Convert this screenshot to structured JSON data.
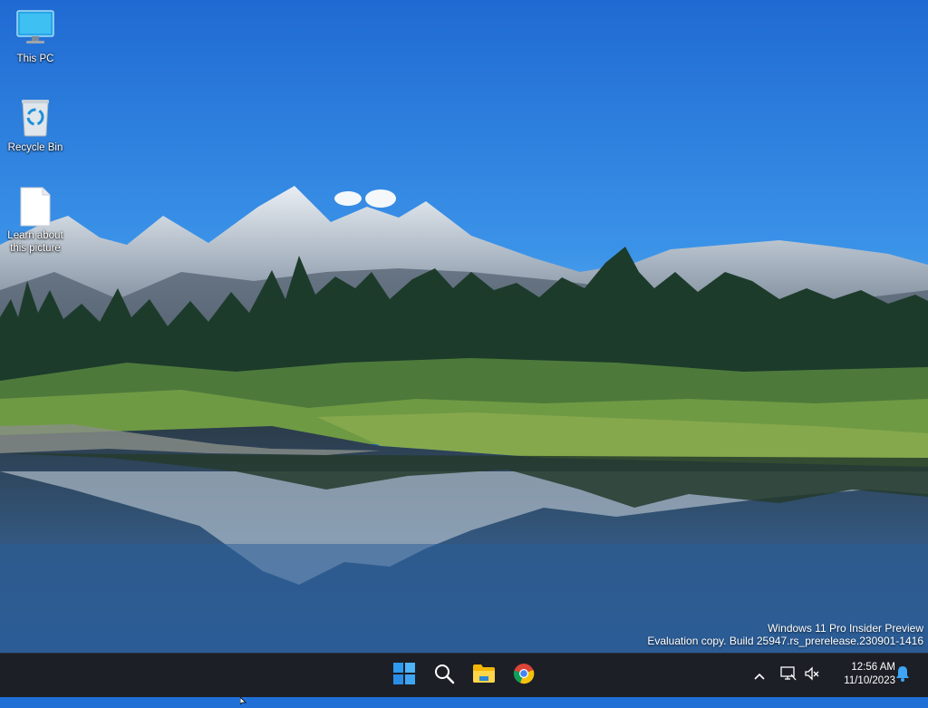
{
  "desktop": {
    "icons": [
      {
        "label": "This PC",
        "icon": "monitor-icon"
      },
      {
        "label": "Recycle Bin",
        "icon": "recycle-bin-icon"
      },
      {
        "label": "Learn about this picture",
        "icon": "document-icon"
      }
    ]
  },
  "watermark": {
    "line1": "Windows 11 Pro Insider Preview",
    "line2": "Evaluation copy. Build 25947.rs_prerelease.230901-1416"
  },
  "taskbar": {
    "pinned": [
      {
        "name": "Start",
        "icon": "windows-logo-icon"
      },
      {
        "name": "Search",
        "icon": "search-icon"
      },
      {
        "name": "File Explorer",
        "icon": "folder-icon"
      },
      {
        "name": "Google Chrome",
        "icon": "chrome-icon"
      }
    ],
    "tray": {
      "chevron_icon": "chevron-up-icon",
      "network_icon": "network-icon",
      "volume_icon": "volume-muted-icon",
      "notification_icon": "bell-icon"
    },
    "clock": {
      "time": "12:56 AM",
      "date": "11/10/2023"
    }
  },
  "colors": {
    "sky_top": "#1f6fd6",
    "sky_bottom": "#64b2ef",
    "taskbar": "#1c1f26",
    "accent": "#3ea5f5"
  }
}
